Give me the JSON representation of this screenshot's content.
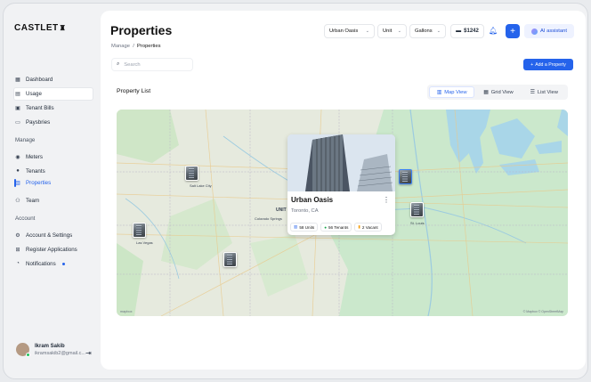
{
  "brand": {
    "name": "CASTLET"
  },
  "sidebar": {
    "top_items": [
      {
        "label": "Dashboard",
        "icon": "grid-icon"
      },
      {
        "label": "Usage",
        "icon": "chart-icon"
      },
      {
        "label": "Tenant Bills",
        "icon": "bill-icon"
      },
      {
        "label": "Paysbries",
        "icon": "wallet-icon"
      }
    ],
    "manage_label": "Manage",
    "manage_items": [
      {
        "label": "Meters",
        "icon": "meter-icon"
      },
      {
        "label": "Tenants",
        "icon": "users-icon"
      },
      {
        "label": "Properties",
        "icon": "building-icon"
      },
      {
        "label": "Team",
        "icon": "team-icon"
      }
    ],
    "account_label": "Account",
    "account_items": [
      {
        "label": "Account & Settings",
        "icon": "settings-icon"
      },
      {
        "label": "Register Applications",
        "icon": "app-icon"
      },
      {
        "label": "Notifications",
        "icon": "bell-icon"
      }
    ],
    "user": {
      "name": "Ikram Sakib",
      "email": "ikramsakib2@gmail.c..."
    }
  },
  "header": {
    "title": "Properties",
    "breadcrumb": {
      "parent": "Manage",
      "separator": "/",
      "current": "Properties"
    },
    "property_select": "Urban Oasis",
    "unit_select": "Unit",
    "measure_select": "Gallons",
    "balance": "$1242",
    "ai_label": "AI assistant"
  },
  "toolbar": {
    "search_placeholder": "Search",
    "add_label": "Add a Property",
    "list_title": "Property List",
    "views": [
      "Map View",
      "Grid View",
      "List View"
    ],
    "active_view": "Map View"
  },
  "map": {
    "labels": {
      "unit": "UNIT",
      "las_vegas": "Las Vegas",
      "colorado_springs": "Colorado Springs",
      "st_louis": "St. Louis",
      "salt_lake": "Salt Lake City"
    },
    "attribution": "© Mapbox © OpenStreetMap"
  },
  "card": {
    "name": "Urban Oasis",
    "location": "Toronto, CA",
    "units": "58 Units",
    "tenants": "56 Tenants",
    "vacant": "2 Vacant"
  },
  "colors": {
    "accent": "#2563eb",
    "water": "#a7d8ea",
    "land": "#e7ecdf",
    "green": "#c9e8c4"
  }
}
